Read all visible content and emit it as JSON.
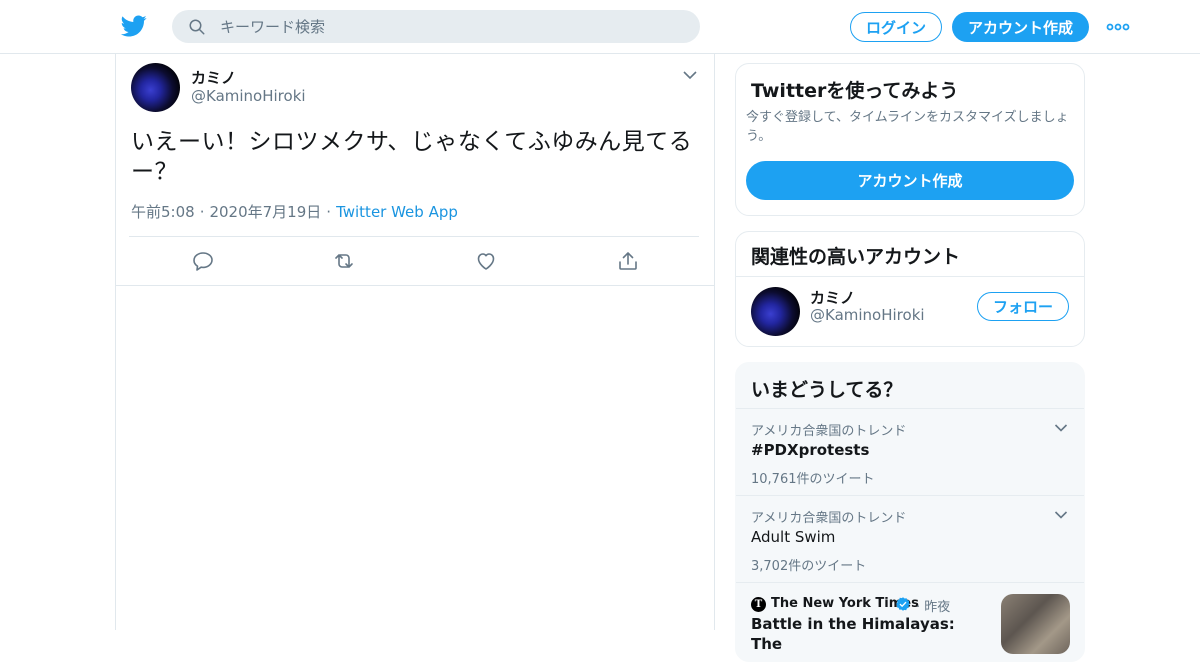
{
  "header": {
    "search_placeholder": "キーワード検索",
    "login_label": "ログイン",
    "signup_label": "アカウント作成"
  },
  "tweet": {
    "display_name": "カミノ",
    "handle": "@KaminoHiroki",
    "text": "いえーい！シロツメクサ、じゃなくてふゆみん見てるー？",
    "time": "午前5:08",
    "date": "2020年7月19日",
    "separator": "·",
    "source": "Twitter Web App"
  },
  "sidebar": {
    "signup_card": {
      "title": "Twitterを使ってみよう",
      "description": "今すぐ登録して、タイムラインをカスタマイズしましょう。",
      "button_label": "アカウント作成"
    },
    "related_card": {
      "title": "関連性の高いアカウント",
      "account_name": "カミノ",
      "account_handle": "@KaminoHiroki",
      "follow_label": "フォロー"
    },
    "trends_card": {
      "title": "いまどうしてる？",
      "items": [
        {
          "context": "アメリカ合衆国のトレンド",
          "name": "#PDXprotests",
          "count": "10,761件のツイート"
        },
        {
          "context": "アメリカ合衆国のトレンド",
          "name": "Adult Swim",
          "count": "3,702件のツイート"
        }
      ],
      "news": {
        "source": "The New York Times",
        "time": "昨夜",
        "separator": "·",
        "headline": "Battle in the Himalayas: The"
      }
    }
  },
  "colors": {
    "accent": "#1da1f2",
    "link": "#1b95e0",
    "muted": "#657786",
    "text": "#14171a",
    "border": "#e1e8ed"
  },
  "icons": [
    "twitter-bird-icon",
    "search-icon",
    "more-dots-icon",
    "chevron-down-icon",
    "reply-icon",
    "retweet-icon",
    "like-icon",
    "share-icon",
    "verified-icon"
  ]
}
